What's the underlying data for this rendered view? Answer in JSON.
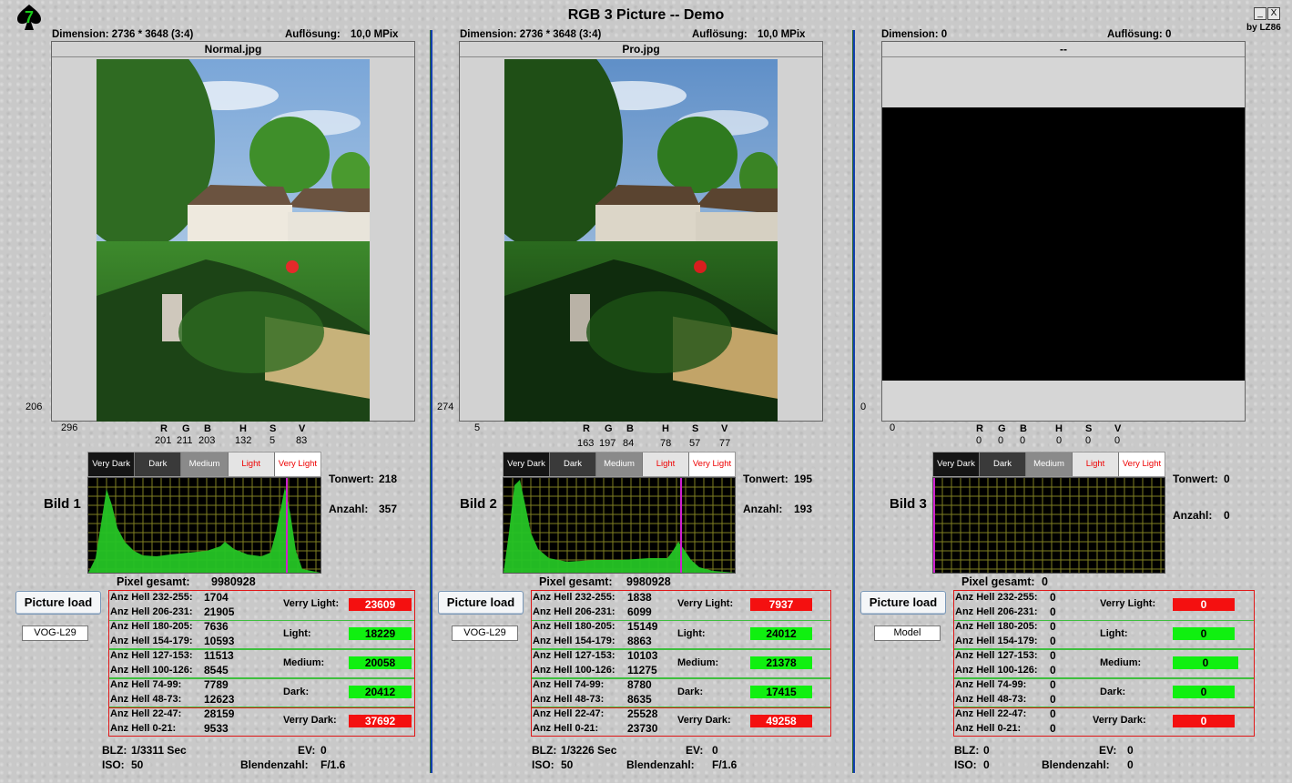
{
  "window": {
    "title": "RGB 3 Picture -- Demo",
    "author": "by LZ86",
    "min_btn": "_",
    "close_btn": "X"
  },
  "colors": {
    "divider": "#123fae",
    "red_pill": "#f41010",
    "green_pill": "#10f010",
    "histogram_fill": "#22c722",
    "grid": "#8a8a2a",
    "marker": "#d020d0"
  },
  "panels": [
    {
      "dim_label": "Dimension: 2736 * 3648 (3:4)",
      "res_label": "Auflösung:",
      "res_value": "10,0 MPix",
      "filename": "Normal.jpg",
      "ypos": "206",
      "xpos": "296",
      "rgb": {
        "R": "201",
        "G": "211",
        "B": "203",
        "H": "132",
        "S": "5",
        "V": "83"
      },
      "bild_label": "Bild 1",
      "tonwert_label": "Tonwert:",
      "tonwert": "218",
      "anzahl_label": "Anzahl:",
      "anzahl": "357",
      "hist_headers": [
        "Very Dark",
        "Dark",
        "Medium",
        "Light",
        "Very Light"
      ],
      "pixel_total_label": "Pixel gesamt:",
      "pixel_total": "9980928",
      "load_btn": "Picture load",
      "model": "VOG-L29",
      "rows": [
        [
          "Anz Hell 232-255:",
          "1704"
        ],
        [
          "Anz Hell 206-231:",
          "21905"
        ],
        [
          "Anz Hell 180-205:",
          "7636"
        ],
        [
          "Anz Hell 154-179:",
          "10593"
        ],
        [
          "Anz Hell 127-153:",
          "11513"
        ],
        [
          "Anz Hell 100-126:",
          "8545"
        ],
        [
          "Anz Hell 74-99:",
          "7789"
        ],
        [
          "Anz Hell 48-73:",
          "12623"
        ],
        [
          "Anz Hell 22-47:",
          "28159"
        ],
        [
          "Anz Hell 0-21:",
          "9533"
        ]
      ],
      "groups": [
        [
          "Verry Light:",
          "23609"
        ],
        [
          "Light:",
          "18229"
        ],
        [
          "Medium:",
          "20058"
        ],
        [
          "Dark:",
          "20412"
        ],
        [
          "Verry Dark:",
          "37692"
        ]
      ],
      "blz_label": "BLZ:",
      "blz": "1/3311 Sec",
      "ev_label": "EV:",
      "ev": "0",
      "iso_label": "ISO:",
      "iso": "50",
      "blende_label": "Blendenzahl:",
      "blende": "F/1.6"
    },
    {
      "dim_label": "Dimension: 2736 * 3648 (3:4)",
      "res_label": "Auflösung:",
      "res_value": "10,0 MPix",
      "filename": "Pro.jpg",
      "ypos": "274",
      "xpos": "5",
      "rgb": {
        "R": "163",
        "G": "197",
        "B": "84",
        "H": "78",
        "S": "57",
        "V": "77"
      },
      "bild_label": "Bild 2",
      "tonwert_label": "Tonwert:",
      "tonwert": "195",
      "anzahl_label": "Anzahl:",
      "anzahl": "193",
      "hist_headers": [
        "Very Dark",
        "Dark",
        "Medium",
        "Light",
        "Very Light"
      ],
      "pixel_total_label": "Pixel gesamt:",
      "pixel_total": "9980928",
      "load_btn": "Picture load",
      "model": "VOG-L29",
      "rows": [
        [
          "Anz Hell 232-255:",
          "1838"
        ],
        [
          "Anz Hell 206-231:",
          "6099"
        ],
        [
          "Anz Hell 180-205:",
          "15149"
        ],
        [
          "Anz Hell 154-179:",
          "8863"
        ],
        [
          "Anz Hell 127-153:",
          "10103"
        ],
        [
          "Anz Hell 100-126:",
          "11275"
        ],
        [
          "Anz Hell 74-99:",
          "8780"
        ],
        [
          "Anz Hell 48-73:",
          "8635"
        ],
        [
          "Anz Hell 22-47:",
          "25528"
        ],
        [
          "Anz Hell 0-21:",
          "23730"
        ]
      ],
      "groups": [
        [
          "Verry Light:",
          "7937"
        ],
        [
          "Light:",
          "24012"
        ],
        [
          "Medium:",
          "21378"
        ],
        [
          "Dark:",
          "17415"
        ],
        [
          "Verry Dark:",
          "49258"
        ]
      ],
      "blz_label": "BLZ:",
      "blz": "1/3226 Sec",
      "ev_label": "EV:",
      "ev": "0",
      "iso_label": "ISO:",
      "iso": "50",
      "blende_label": "Blendenzahl:",
      "blende": "F/1.6"
    },
    {
      "dim_label": "Dimension: 0",
      "res_label": "Auflösung:",
      "res_value": "0",
      "filename": "--",
      "ypos": "0",
      "xpos": "0",
      "rgb": {
        "R": "0",
        "G": "0",
        "B": "0",
        "H": "0",
        "S": "0",
        "V": "0"
      },
      "bild_label": "Bild 3",
      "tonwert_label": "Tonwert:",
      "tonwert": "0",
      "anzahl_label": "Anzahl:",
      "anzahl": "0",
      "hist_headers": [
        "Very Dark",
        "Dark",
        "Medium",
        "Light",
        "Very Light"
      ],
      "pixel_total_label": "Pixel gesamt:",
      "pixel_total": "0",
      "load_btn": "Picture load",
      "model": "Model",
      "rows": [
        [
          "Anz Hell 232-255:",
          "0"
        ],
        [
          "Anz Hell 206-231:",
          "0"
        ],
        [
          "Anz Hell 180-205:",
          "0"
        ],
        [
          "Anz Hell 154-179:",
          "0"
        ],
        [
          "Anz Hell 127-153:",
          "0"
        ],
        [
          "Anz Hell 100-126:",
          "0"
        ],
        [
          "Anz Hell 74-99:",
          "0"
        ],
        [
          "Anz Hell 48-73:",
          "0"
        ],
        [
          "Anz Hell 22-47:",
          "0"
        ],
        [
          "Anz Hell 0-21:",
          "0"
        ]
      ],
      "groups": [
        [
          "Verry Light:",
          "0"
        ],
        [
          "Light:",
          "0"
        ],
        [
          "Medium:",
          "0"
        ],
        [
          "Dark:",
          "0"
        ],
        [
          "Verry Dark:",
          "0"
        ]
      ],
      "blz_label": "BLZ:",
      "blz": "0",
      "ev_label": "EV:",
      "ev": "0",
      "iso_label": "ISO:",
      "iso": "0",
      "blende_label": "Blendenzahl:",
      "blende": "0"
    }
  ]
}
